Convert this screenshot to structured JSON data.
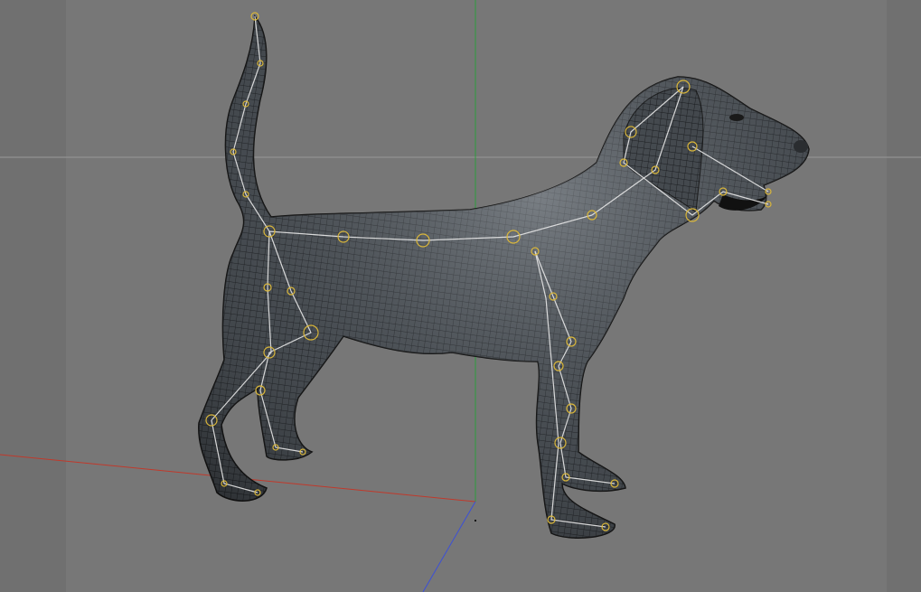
{
  "viewport": {
    "background": "#777777",
    "safe_frame_shade": "#6a6a6a",
    "grid_line_color": "#9a9a9a"
  },
  "axes": {
    "x_color": "#c0392b",
    "y_color": "#2e9e3e",
    "z_color": "#3b4fd8"
  },
  "model": {
    "mesh_fill": "#3e4247",
    "wire_color": "#16181b",
    "highlight_color": "#8e959c",
    "bone_color": "#e8e8e8",
    "joint_color": "#d9b63a"
  },
  "icons": {
    "mesh": "polygon-mesh-icon",
    "rig": "bone-rig-icon"
  }
}
